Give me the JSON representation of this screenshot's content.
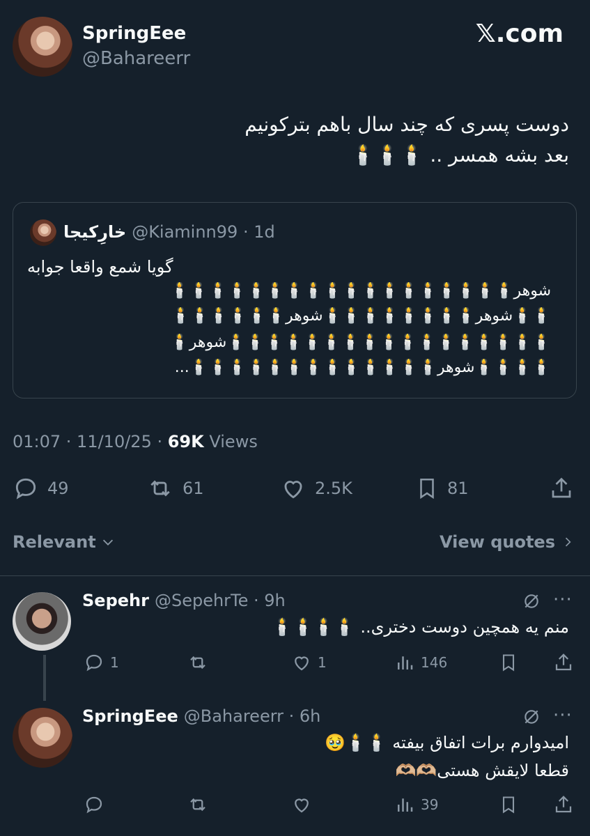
{
  "brand": {
    "site": "𝕏.com"
  },
  "post": {
    "author_name": "SpringEee",
    "author_handle": "@Bahareerr",
    "text_line1": "دوست پسری که چند سال باهم بترکونیم",
    "text_line2": "بعد بشه همسر .. 🕯️🕯️🕯️",
    "timestamp": "01:07 · 11/10/25 · ",
    "views_count": "69K",
    "views_label": " Views",
    "stats": {
      "replies": "49",
      "reposts": "61",
      "likes": "2.5K",
      "bookmarks": "81"
    }
  },
  "quoted": {
    "author_name": "خارِکیجا",
    "author_handle": "@Kiaminn99 · 1d",
    "line1": "گویا شمع واقعا جوابه",
    "line2": "شوهر🕯️🕯️🕯️🕯️🕯️🕯️🕯️🕯️🕯️🕯️🕯️🕯️🕯️🕯️🕯️🕯️🕯️🕯️",
    "line3": "🕯️🕯️شوهر🕯️🕯️🕯️🕯️🕯️🕯️🕯️🕯️شوهر🕯️🕯️🕯️🕯️🕯️🕯️",
    "line4": "🕯️🕯️🕯️🕯️🕯️🕯️🕯️🕯️🕯️🕯️🕯️🕯️🕯️🕯️🕯️🕯️🕯️شوهر🕯️",
    "line5": "🕯️🕯️🕯️🕯️شوهر🕯️🕯️🕯️🕯️🕯️🕯️🕯️🕯️🕯️🕯️🕯️🕯️🕯️...",
    "line2_bold": ""
  },
  "sort": {
    "label": "Relevant",
    "view_quotes": "View quotes"
  },
  "replies": [
    {
      "author_name": "Sepehr",
      "author_handle": "@SepehrTe · 9h",
      "text_line1": "منم یه همچین دوست دختری.. 🕯️🕯️🕯️🕯️",
      "text_line2": "",
      "stats": {
        "replies": "1",
        "reposts": "",
        "likes": "1",
        "views": "146"
      }
    },
    {
      "author_name": "SpringEee",
      "author_handle": "@Bahareerr · 6h",
      "text_line1": "امیدوارم برات اتفاق بیفته 🕯️🕯️🥹",
      "text_line2": "قطعا لایقش هستی🫶🏼🫶🏼",
      "stats": {
        "replies": "",
        "reposts": "",
        "likes": "",
        "views": "39"
      }
    }
  ],
  "colors": {
    "background": "#15202b",
    "muted": "#8b98a5",
    "border": "#38444d",
    "text": "#f7f9f9"
  }
}
